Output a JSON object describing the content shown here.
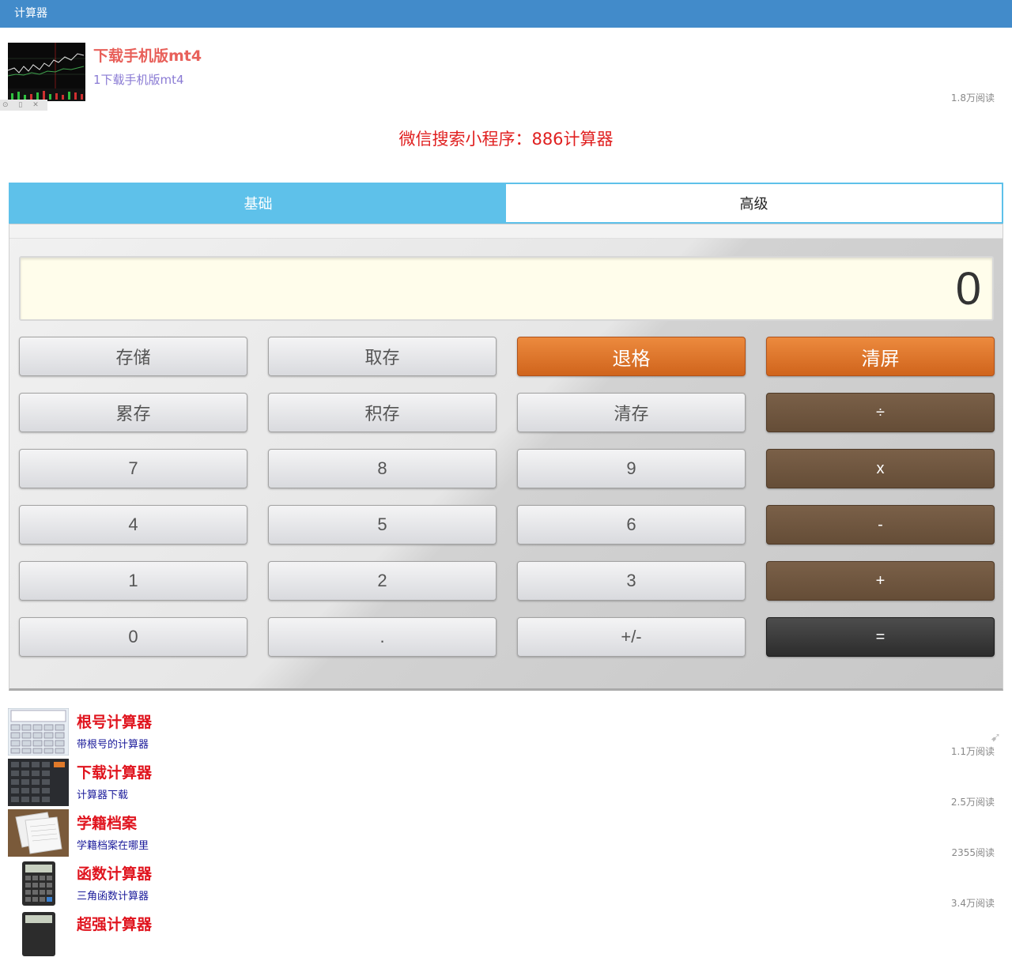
{
  "header": {
    "title": "计算器"
  },
  "ad": {
    "title": "下载手机版mt4",
    "subtitle": "1下载手机版mt4",
    "reads": "1.8万阅读"
  },
  "promo": {
    "text": "微信搜索小程序：886计算器"
  },
  "tabs": [
    {
      "label": "基础",
      "active": true
    },
    {
      "label": "高级",
      "active": false
    }
  ],
  "calculator": {
    "display": "0",
    "buttons": [
      {
        "label": "存储",
        "style": "gray"
      },
      {
        "label": "取存",
        "style": "gray"
      },
      {
        "label": "退格",
        "style": "orange"
      },
      {
        "label": "清屏",
        "style": "orange"
      },
      {
        "label": "累存",
        "style": "gray"
      },
      {
        "label": "积存",
        "style": "gray"
      },
      {
        "label": "清存",
        "style": "gray"
      },
      {
        "label": "÷",
        "style": "brown"
      },
      {
        "label": "7",
        "style": "gray"
      },
      {
        "label": "8",
        "style": "gray"
      },
      {
        "label": "9",
        "style": "gray"
      },
      {
        "label": "x",
        "style": "brown"
      },
      {
        "label": "4",
        "style": "gray"
      },
      {
        "label": "5",
        "style": "gray"
      },
      {
        "label": "6",
        "style": "gray"
      },
      {
        "label": "-",
        "style": "brown"
      },
      {
        "label": "1",
        "style": "gray"
      },
      {
        "label": "2",
        "style": "gray"
      },
      {
        "label": "3",
        "style": "gray"
      },
      {
        "label": "+",
        "style": "brown"
      },
      {
        "label": "0",
        "style": "gray"
      },
      {
        "label": ".",
        "style": "gray"
      },
      {
        "label": "+/-",
        "style": "gray"
      },
      {
        "label": "=",
        "style": "dark"
      }
    ]
  },
  "articles": [
    {
      "title": "根号计算器",
      "subtitle": "带根号的计算器",
      "reads": "1.1万阅读"
    },
    {
      "title": "下载计算器",
      "subtitle": "计算器下载",
      "reads": "2.5万阅读"
    },
    {
      "title": "学籍档案",
      "subtitle": "学籍档案在哪里",
      "reads": "2355阅读"
    },
    {
      "title": "函数计算器",
      "subtitle": "三角函数计算器",
      "reads": "3.4万阅读"
    },
    {
      "title": "超强计算器",
      "subtitle": "",
      "reads": ""
    }
  ]
}
